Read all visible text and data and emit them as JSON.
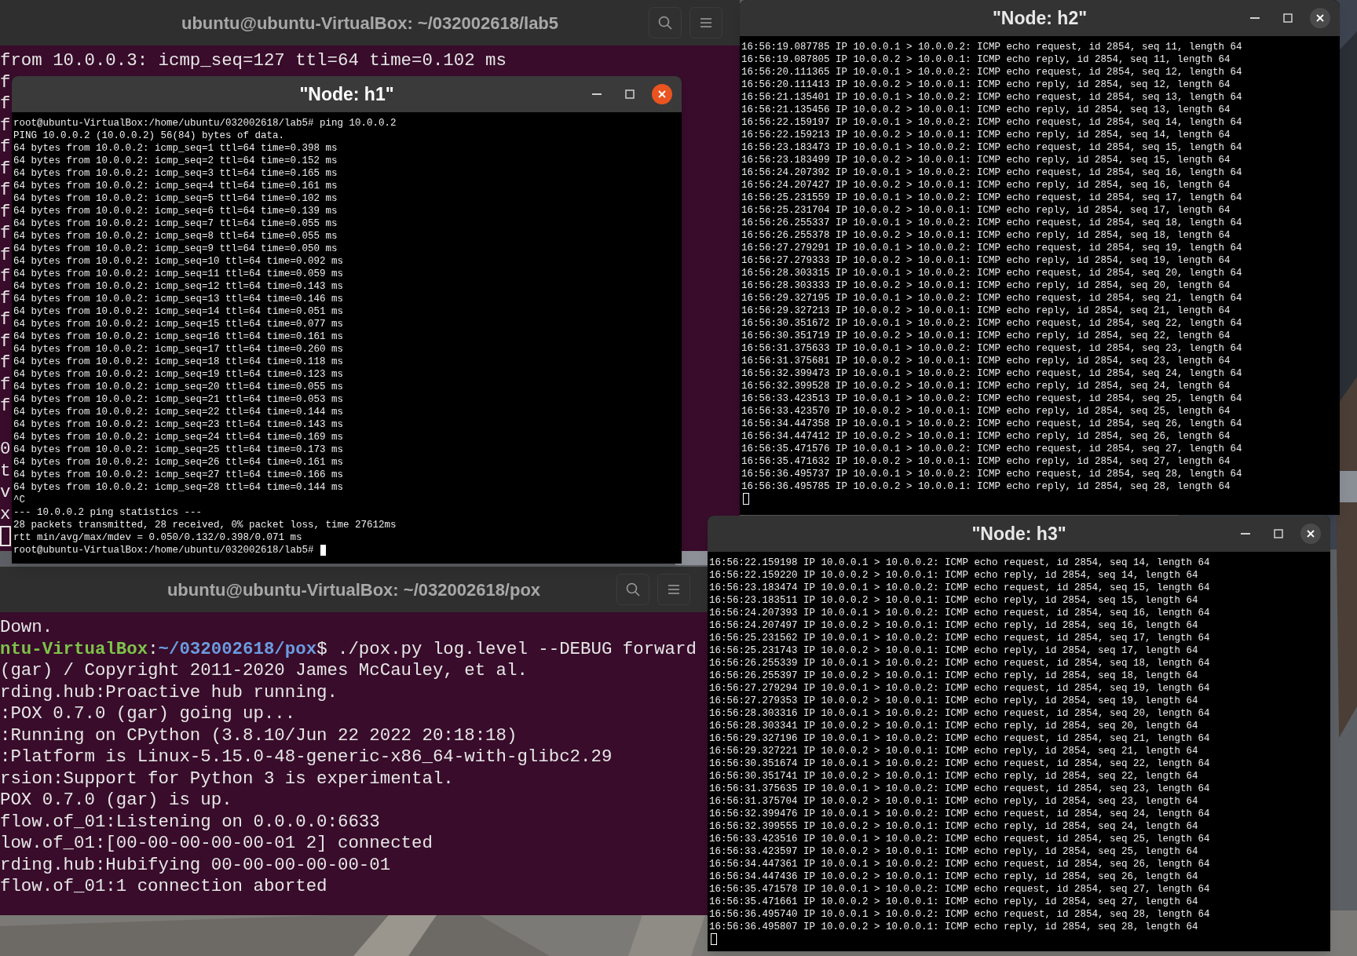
{
  "terminals": [
    {
      "title": "ubuntu@ubuntu-VirtualBox: ~/032002618/lab5",
      "lines": [
        {
          "segments": [
            {
              "kind": "plain",
              "text": "from 10.0.0.3: icmp_seq=127 ttl=64 time=0.102 ms"
            }
          ]
        }
      ],
      "edge_blocks": [
        [
          "f",
          "f",
          "f",
          "f",
          "f",
          "f",
          "f",
          "f",
          "f",
          "f",
          "f",
          "f",
          "f",
          "f",
          "f",
          "f"
        ],
        [
          "0",
          "t",
          "v",
          "x"
        ]
      ],
      "cursor": {
        "kind": "outline"
      }
    },
    {
      "title": "ubuntu@ubuntu-VirtualBox: ~/032002618/pox",
      "lines": [
        {
          "segments": [
            {
              "kind": "plain",
              "text": "Down."
            }
          ]
        },
        {
          "segments": [
            {
              "kind": "host",
              "text": "ntu-VirtualBox"
            },
            {
              "kind": "plain",
              "text": ":"
            },
            {
              "kind": "path",
              "text": "~/032002618/pox"
            },
            {
              "kind": "plain",
              "text": "$ ./pox.py log.level --DEBUG forward"
            }
          ]
        },
        {
          "segments": [
            {
              "kind": "plain",
              "text": "(gar) / Copyright 2011-2020 James McCauley, et al."
            }
          ]
        },
        {
          "segments": [
            {
              "kind": "plain",
              "text": "rding.hub:Proactive hub running."
            }
          ]
        },
        {
          "segments": [
            {
              "kind": "plain",
              "text": ":POX 0.7.0 (gar) going up..."
            }
          ]
        },
        {
          "segments": [
            {
              "kind": "plain",
              "text": ":Running on CPython (3.8.10/Jun 22 2022 20:18:18)"
            }
          ]
        },
        {
          "segments": [
            {
              "kind": "plain",
              "text": ":Platform is Linux-5.15.0-48-generic-x86_64-with-glibc2.29"
            }
          ]
        },
        {
          "segments": [
            {
              "kind": "plain",
              "text": "rsion:Support for Python 3 is experimental."
            }
          ]
        },
        {
          "segments": [
            {
              "kind": "plain",
              "text": "POX 0.7.0 (gar) is up."
            }
          ]
        },
        {
          "segments": [
            {
              "kind": "plain",
              "text": "flow.of_01:Listening on 0.0.0.0:6633"
            }
          ]
        },
        {
          "segments": [
            {
              "kind": "plain",
              "text": "low.of_01:[00-00-00-00-00-01 2] connected"
            }
          ]
        },
        {
          "segments": [
            {
              "kind": "plain",
              "text": "rding.hub:Hubifying 00-00-00-00-00-01"
            }
          ]
        },
        {
          "segments": [
            {
              "kind": "plain",
              "text": "flow.of_01:1 connection aborted"
            }
          ]
        }
      ]
    }
  ],
  "node_windows": [
    {
      "title": "\"Node: h1\"",
      "focused": true,
      "cursor": {
        "kind": "block"
      },
      "lines": [
        "root@ubuntu-VirtualBox:/home/ubuntu/032002618/lab5# ping 10.0.0.2",
        "PING 10.0.0.2 (10.0.0.2) 56(84) bytes of data.",
        "64 bytes from 10.0.0.2: icmp_seq=1 ttl=64 time=0.398 ms",
        "64 bytes from 10.0.0.2: icmp_seq=2 ttl=64 time=0.152 ms",
        "64 bytes from 10.0.0.2: icmp_seq=3 ttl=64 time=0.165 ms",
        "64 bytes from 10.0.0.2: icmp_seq=4 ttl=64 time=0.161 ms",
        "64 bytes from 10.0.0.2: icmp_seq=5 ttl=64 time=0.102 ms",
        "64 bytes from 10.0.0.2: icmp_seq=6 ttl=64 time=0.139 ms",
        "64 bytes from 10.0.0.2: icmp_seq=7 ttl=64 time=0.055 ms",
        "64 bytes from 10.0.0.2: icmp_seq=8 ttl=64 time=0.055 ms",
        "64 bytes from 10.0.0.2: icmp_seq=9 ttl=64 time=0.050 ms",
        "64 bytes from 10.0.0.2: icmp_seq=10 ttl=64 time=0.092 ms",
        "64 bytes from 10.0.0.2: icmp_seq=11 ttl=64 time=0.059 ms",
        "64 bytes from 10.0.0.2: icmp_seq=12 ttl=64 time=0.143 ms",
        "64 bytes from 10.0.0.2: icmp_seq=13 ttl=64 time=0.146 ms",
        "64 bytes from 10.0.0.2: icmp_seq=14 ttl=64 time=0.051 ms",
        "64 bytes from 10.0.0.2: icmp_seq=15 ttl=64 time=0.077 ms",
        "64 bytes from 10.0.0.2: icmp_seq=16 ttl=64 time=0.161 ms",
        "64 bytes from 10.0.0.2: icmp_seq=17 ttl=64 time=0.260 ms",
        "64 bytes from 10.0.0.2: icmp_seq=18 ttl=64 time=0.118 ms",
        "64 bytes from 10.0.0.2: icmp_seq=19 ttl=64 time=0.123 ms",
        "64 bytes from 10.0.0.2: icmp_seq=20 ttl=64 time=0.055 ms",
        "64 bytes from 10.0.0.2: icmp_seq=21 ttl=64 time=0.053 ms",
        "64 bytes from 10.0.0.2: icmp_seq=22 ttl=64 time=0.144 ms",
        "64 bytes from 10.0.0.2: icmp_seq=23 ttl=64 time=0.143 ms",
        "64 bytes from 10.0.0.2: icmp_seq=24 ttl=64 time=0.169 ms",
        "64 bytes from 10.0.0.2: icmp_seq=25 ttl=64 time=0.173 ms",
        "64 bytes from 10.0.0.2: icmp_seq=26 ttl=64 time=0.161 ms",
        "64 bytes from 10.0.0.2: icmp_seq=27 ttl=64 time=0.166 ms",
        "64 bytes from 10.0.0.2: icmp_seq=28 ttl=64 time=0.144 ms",
        "^C",
        "--- 10.0.0.2 ping statistics ---",
        "28 packets transmitted, 28 received, 0% packet loss, time 27612ms",
        "rtt min/avg/max/mdev = 0.050/0.132/0.398/0.071 ms",
        "root@ubuntu-VirtualBox:/home/ubuntu/032002618/lab5#"
      ]
    },
    {
      "title": "\"Node: h2\"",
      "focused": false,
      "cursor": {
        "kind": "outline"
      },
      "lines": [
        "16:56:19.087785 IP 10.0.0.1 > 10.0.0.2: ICMP echo request, id 2854, seq 11, length 64",
        "16:56:19.087805 IP 10.0.0.2 > 10.0.0.1: ICMP echo reply, id 2854, seq 11, length 64",
        "16:56:20.111365 IP 10.0.0.1 > 10.0.0.2: ICMP echo request, id 2854, seq 12, length 64",
        "16:56:20.111413 IP 10.0.0.2 > 10.0.0.1: ICMP echo reply, id 2854, seq 12, length 64",
        "16:56:21.135401 IP 10.0.0.1 > 10.0.0.2: ICMP echo request, id 2854, seq 13, length 64",
        "16:56:21.135456 IP 10.0.0.2 > 10.0.0.1: ICMP echo reply, id 2854, seq 13, length 64",
        "16:56:22.159197 IP 10.0.0.1 > 10.0.0.2: ICMP echo request, id 2854, seq 14, length 64",
        "16:56:22.159213 IP 10.0.0.2 > 10.0.0.1: ICMP echo reply, id 2854, seq 14, length 64",
        "16:56:23.183473 IP 10.0.0.1 > 10.0.0.2: ICMP echo request, id 2854, seq 15, length 64",
        "16:56:23.183499 IP 10.0.0.2 > 10.0.0.1: ICMP echo reply, id 2854, seq 15, length 64",
        "16:56:24.207392 IP 10.0.0.1 > 10.0.0.2: ICMP echo request, id 2854, seq 16, length 64",
        "16:56:24.207427 IP 10.0.0.2 > 10.0.0.1: ICMP echo reply, id 2854, seq 16, length 64",
        "16:56:25.231559 IP 10.0.0.1 > 10.0.0.2: ICMP echo request, id 2854, seq 17, length 64",
        "16:56:25.231704 IP 10.0.0.2 > 10.0.0.1: ICMP echo reply, id 2854, seq 17, length 64",
        "16:56:26.255337 IP 10.0.0.1 > 10.0.0.2: ICMP echo request, id 2854, seq 18, length 64",
        "16:56:26.255378 IP 10.0.0.2 > 10.0.0.1: ICMP echo reply, id 2854, seq 18, length 64",
        "16:56:27.279291 IP 10.0.0.1 > 10.0.0.2: ICMP echo request, id 2854, seq 19, length 64",
        "16:56:27.279333 IP 10.0.0.2 > 10.0.0.1: ICMP echo reply, id 2854, seq 19, length 64",
        "16:56:28.303315 IP 10.0.0.1 > 10.0.0.2: ICMP echo request, id 2854, seq 20, length 64",
        "16:56:28.303333 IP 10.0.0.2 > 10.0.0.1: ICMP echo reply, id 2854, seq 20, length 64",
        "16:56:29.327195 IP 10.0.0.1 > 10.0.0.2: ICMP echo request, id 2854, seq 21, length 64",
        "16:56:29.327213 IP 10.0.0.2 > 10.0.0.1: ICMP echo reply, id 2854, seq 21, length 64",
        "16:56:30.351672 IP 10.0.0.1 > 10.0.0.2: ICMP echo request, id 2854, seq 22, length 64",
        "16:56:30.351719 IP 10.0.0.2 > 10.0.0.1: ICMP echo reply, id 2854, seq 22, length 64",
        "16:56:31.375633 IP 10.0.0.1 > 10.0.0.2: ICMP echo request, id 2854, seq 23, length 64",
        "16:56:31.375681 IP 10.0.0.2 > 10.0.0.1: ICMP echo reply, id 2854, seq 23, length 64",
        "16:56:32.399473 IP 10.0.0.1 > 10.0.0.2: ICMP echo request, id 2854, seq 24, length 64",
        "16:56:32.399528 IP 10.0.0.2 > 10.0.0.1: ICMP echo reply, id 2854, seq 24, length 64",
        "16:56:33.423513 IP 10.0.0.1 > 10.0.0.2: ICMP echo request, id 2854, seq 25, length 64",
        "16:56:33.423570 IP 10.0.0.2 > 10.0.0.1: ICMP echo reply, id 2854, seq 25, length 64",
        "16:56:34.447358 IP 10.0.0.1 > 10.0.0.2: ICMP echo request, id 2854, seq 26, length 64",
        "16:56:34.447412 IP 10.0.0.2 > 10.0.0.1: ICMP echo reply, id 2854, seq 26, length 64",
        "16:56:35.471576 IP 10.0.0.1 > 10.0.0.2: ICMP echo request, id 2854, seq 27, length 64",
        "16:56:35.471632 IP 10.0.0.2 > 10.0.0.1: ICMP echo reply, id 2854, seq 27, length 64",
        "16:56:36.495737 IP 10.0.0.1 > 10.0.0.2: ICMP echo request, id 2854, seq 28, length 64",
        "16:56:36.495785 IP 10.0.0.2 > 10.0.0.1: ICMP echo reply, id 2854, seq 28, length 64"
      ]
    },
    {
      "title": "\"Node: h3\"",
      "focused": false,
      "cursor": {
        "kind": "outline"
      },
      "lines": [
        "16:56:22.159198 IP 10.0.0.1 > 10.0.0.2: ICMP echo request, id 2854, seq 14, length 64",
        "16:56:22.159220 IP 10.0.0.2 > 10.0.0.1: ICMP echo reply, id 2854, seq 14, length 64",
        "16:56:23.183474 IP 10.0.0.1 > 10.0.0.2: ICMP echo request, id 2854, seq 15, length 64",
        "16:56:23.183511 IP 10.0.0.2 > 10.0.0.1: ICMP echo reply, id 2854, seq 15, length 64",
        "16:56:24.207393 IP 10.0.0.1 > 10.0.0.2: ICMP echo request, id 2854, seq 16, length 64",
        "16:56:24.207497 IP 10.0.0.2 > 10.0.0.1: ICMP echo reply, id 2854, seq 16, length 64",
        "16:56:25.231562 IP 10.0.0.1 > 10.0.0.2: ICMP echo request, id 2854, seq 17, length 64",
        "16:56:25.231743 IP 10.0.0.2 > 10.0.0.1: ICMP echo reply, id 2854, seq 17, length 64",
        "16:56:26.255339 IP 10.0.0.1 > 10.0.0.2: ICMP echo request, id 2854, seq 18, length 64",
        "16:56:26.255397 IP 10.0.0.2 > 10.0.0.1: ICMP echo reply, id 2854, seq 18, length 64",
        "16:56:27.279294 IP 10.0.0.1 > 10.0.0.2: ICMP echo request, id 2854, seq 19, length 64",
        "16:56:27.279353 IP 10.0.0.2 > 10.0.0.1: ICMP echo reply, id 2854, seq 19, length 64",
        "16:56:28.303316 IP 10.0.0.1 > 10.0.0.2: ICMP echo request, id 2854, seq 20, length 64",
        "16:56:28.303341 IP 10.0.0.2 > 10.0.0.1: ICMP echo reply, id 2854, seq 20, length 64",
        "16:56:29.327196 IP 10.0.0.1 > 10.0.0.2: ICMP echo request, id 2854, seq 21, length 64",
        "16:56:29.327221 IP 10.0.0.2 > 10.0.0.1: ICMP echo reply, id 2854, seq 21, length 64",
        "16:56:30.351674 IP 10.0.0.1 > 10.0.0.2: ICMP echo request, id 2854, seq 22, length 64",
        "16:56:30.351741 IP 10.0.0.2 > 10.0.0.1: ICMP echo reply, id 2854, seq 22, length 64",
        "16:56:31.375635 IP 10.0.0.1 > 10.0.0.2: ICMP echo request, id 2854, seq 23, length 64",
        "16:56:31.375704 IP 10.0.0.2 > 10.0.0.1: ICMP echo reply, id 2854, seq 23, length 64",
        "16:56:32.399476 IP 10.0.0.1 > 10.0.0.2: ICMP echo request, id 2854, seq 24, length 64",
        "16:56:32.399555 IP 10.0.0.2 > 10.0.0.1: ICMP echo reply, id 2854, seq 24, length 64",
        "16:56:33.423516 IP 10.0.0.1 > 10.0.0.2: ICMP echo request, id 2854, seq 25, length 64",
        "16:56:33.423597 IP 10.0.0.2 > 10.0.0.1: ICMP echo reply, id 2854, seq 25, length 64",
        "16:56:34.447361 IP 10.0.0.1 > 10.0.0.2: ICMP echo request, id 2854, seq 26, length 64",
        "16:56:34.447436 IP 10.0.0.2 > 10.0.0.1: ICMP echo reply, id 2854, seq 26, length 64",
        "16:56:35.471578 IP 10.0.0.1 > 10.0.0.2: ICMP echo request, id 2854, seq 27, length 64",
        "16:56:35.471661 IP 10.0.0.2 > 10.0.0.1: ICMP echo reply, id 2854, seq 27, length 64",
        "16:56:36.495740 IP 10.0.0.1 > 10.0.0.2: ICMP echo request, id 2854, seq 28, length 64",
        "16:56:36.495807 IP 10.0.0.2 > 10.0.0.1: ICMP echo reply, id 2854, seq 28, length 64"
      ]
    }
  ]
}
